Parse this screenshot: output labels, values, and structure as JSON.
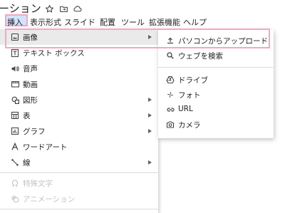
{
  "doc_title": "ーション",
  "menubar": [
    {
      "label": "挿入"
    },
    {
      "label": "表示形式"
    },
    {
      "label": "スライド"
    },
    {
      "label": "配置"
    },
    {
      "label": "ツール"
    },
    {
      "label": "拡張機能"
    },
    {
      "label": "ヘルプ"
    }
  ],
  "insert_menu": {
    "items": [
      {
        "label": "画像",
        "icon": "image-icon",
        "submenu": true
      },
      {
        "label": "テキスト ボックス",
        "icon": "text-box-icon",
        "submenu": false
      },
      {
        "label": "音声",
        "icon": "audio-icon",
        "submenu": false
      },
      {
        "label": "動画",
        "icon": "video-icon",
        "submenu": false
      },
      {
        "label": "図形",
        "icon": "shape-icon",
        "submenu": true
      },
      {
        "label": "表",
        "icon": "table-icon",
        "submenu": true
      },
      {
        "label": "グラフ",
        "icon": "chart-icon",
        "submenu": true
      },
      {
        "label": "ワードアート",
        "icon": "word-art-icon",
        "submenu": false
      },
      {
        "label": "線",
        "icon": "line-icon",
        "submenu": true
      },
      {
        "label": "特殊文字",
        "icon": "omega-icon",
        "submenu": false,
        "disabled": true
      },
      {
        "label": "アニメーション",
        "icon": "animation-icon",
        "submenu": false,
        "disabled": true
      }
    ]
  },
  "image_submenu": {
    "items": [
      {
        "label": "パソコンからアップロード",
        "icon": "upload-icon"
      },
      {
        "label": "ウェブを検索",
        "icon": "search-icon"
      },
      {
        "label": "ドライブ",
        "icon": "drive-icon"
      },
      {
        "label": "フォト",
        "icon": "photos-icon"
      },
      {
        "label": "URL",
        "icon": "link-icon"
      },
      {
        "label": "カメラ",
        "icon": "camera-icon"
      }
    ]
  },
  "colors": {
    "highlight": "#f3a6c6",
    "selected_menu_bg": "#d3e3fd",
    "hover_bg": "#eaeaea"
  }
}
